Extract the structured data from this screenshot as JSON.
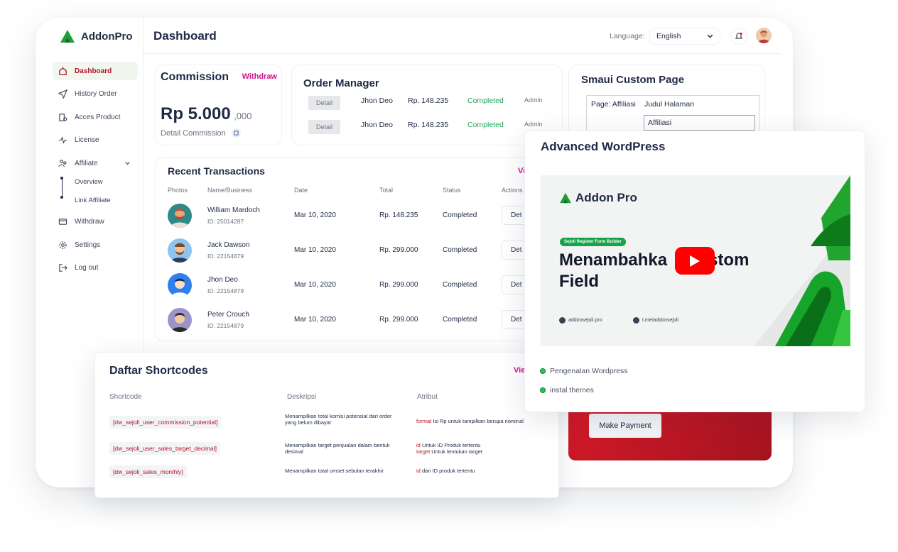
{
  "app": {
    "name": "AddonPro"
  },
  "sidebar": {
    "items": [
      {
        "label": "Dashboard",
        "icon": "home-icon",
        "active": true
      },
      {
        "label": "History Order",
        "icon": "send-icon"
      },
      {
        "label": "Acces Product",
        "icon": "product-icon"
      },
      {
        "label": "License",
        "icon": "pulse-icon"
      },
      {
        "label": "Affiliate",
        "icon": "users-icon"
      },
      {
        "label": "Withdraw",
        "icon": "wallet-icon"
      },
      {
        "label": "Settings",
        "icon": "gear-icon"
      },
      {
        "label": "Log out",
        "icon": "logout-icon"
      }
    ],
    "affiliate_sub": [
      "Overview",
      "Link Affiliate"
    ]
  },
  "header": {
    "title": "Dashboard",
    "language_label": "Language:",
    "language_value": "English"
  },
  "commission": {
    "title": "Commission",
    "withdraw_label": "Withdraw",
    "amount": "Rp 5.000",
    "amount_decimals": ",000",
    "detail_label": "Detail Commission"
  },
  "order_manager": {
    "title": "Order Manager",
    "rows": [
      {
        "button": "Detail",
        "name": "Jhon Deo",
        "amount": "Rp. 148.235",
        "status": "Completed",
        "role": "Admin"
      },
      {
        "button": "Detail",
        "name": "Jhon Deo",
        "amount": "Rp. 148.235",
        "status": "Completed",
        "role": "Admin"
      }
    ]
  },
  "custom_page": {
    "title": "Smaui Custom Page",
    "page_label": "Page: Affiliasi",
    "field_label": "Judul Halaman",
    "field_value": "Affiliasi"
  },
  "transactions": {
    "title": "Recent Transactions",
    "view_label": "Vi",
    "columns": [
      "Photos",
      "Name/Business",
      "Date",
      "Total",
      "Status",
      "Actions"
    ],
    "rows": [
      {
        "name": "William Mardoch",
        "id": "ID: 25014287",
        "date": "Mar 10, 2020",
        "total": "Rp. 148.235",
        "status": "Completed",
        "action": "Det"
      },
      {
        "name": "Jack Dawson",
        "id": "ID: 22154879",
        "date": "Mar 10, 2020",
        "total": "Rp. 299.000",
        "status": "Completed",
        "action": "Det"
      },
      {
        "name": "Jhon Deo",
        "id": "ID: 22154879",
        "date": "Mar 10, 2020",
        "total": "Rp. 299.000",
        "status": "Completed",
        "action": "Det"
      },
      {
        "name": "Peter Crouch",
        "id": "ID: 22154879",
        "date": "Mar 10, 2020",
        "total": "Rp. 299.000",
        "status": "Completed",
        "action": "Det"
      }
    ]
  },
  "shortcodes": {
    "title": "Daftar Shortcodes",
    "view_label": "Vie",
    "columns": [
      "Shortcode",
      "Deskripsi",
      "Atribut"
    ],
    "rows": [
      {
        "code": "[dw_sejoli_user_commission_potential]",
        "desc": "Menampilkan total komisi potensial dari order yang belum dibayar",
        "attr_kw": "format",
        "attr_text": "Isi Rp untuk tampilkan berupa nominal",
        "attr_kw2": "",
        "attr_text2": ""
      },
      {
        "code": "[dw_sejoli_user_sales_target_decimal]",
        "desc": "Menampilkan target penjualan dalam bentuk desimal",
        "attr_kw": "id",
        "attr_text": "Untuk ID Produk tertentu",
        "attr_kw2": "target",
        "attr_text2": "Untuk tentukan target"
      },
      {
        "code": "[dw_sejoli_sales_monthly]",
        "desc": "Menampilkan total omset sebulan terakhir",
        "attr_kw": "id",
        "attr_text": "dari ID produk tertentu",
        "attr_kw2": "",
        "attr_text2": ""
      }
    ]
  },
  "wordpress": {
    "title": "Advanced WordPress",
    "video": {
      "brand": "Addon Pro",
      "badge": "Sejoli Register Form Builder",
      "headline_1": "Menambahka",
      "headline_1b": "stom",
      "headline_2": "Field",
      "site": "addonsejoli.pro",
      "telegram": "t.me/addonsejoli"
    },
    "list": [
      "Pengenalan Wordpress",
      "instal themes"
    ]
  },
  "payment": {
    "button": "Make Payment"
  },
  "colors": {
    "brand_green": "#22a35a",
    "accent_pink": "#d0138a",
    "danger_red": "#b0152a",
    "youtube_red": "#ff0000"
  }
}
